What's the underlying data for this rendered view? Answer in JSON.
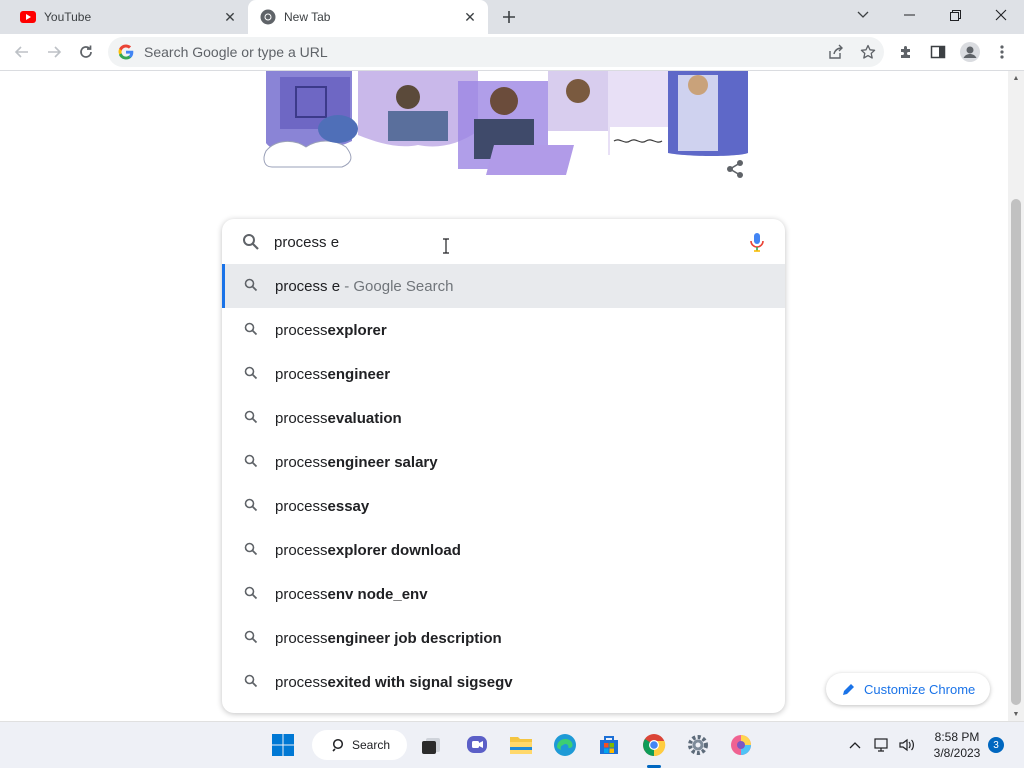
{
  "tabs": [
    {
      "title": "YouTube",
      "icon": "youtube-icon"
    },
    {
      "title": "New Tab",
      "icon": "chrome-icon"
    }
  ],
  "toolbar": {
    "omnibox_placeholder": "Search Google or type a URL"
  },
  "search": {
    "query": "process e",
    "suggestions": [
      {
        "prefix": "process e",
        "suffix": "",
        "note": " - Google Search",
        "selected": true
      },
      {
        "prefix": "process ",
        "suffix": "explorer",
        "note": ""
      },
      {
        "prefix": "process ",
        "suffix": "engineer",
        "note": ""
      },
      {
        "prefix": "process ",
        "suffix": "evaluation",
        "note": ""
      },
      {
        "prefix": "process ",
        "suffix": "engineer salary",
        "note": ""
      },
      {
        "prefix": "process ",
        "suffix": "essay",
        "note": ""
      },
      {
        "prefix": "process ",
        "suffix": "explorer download",
        "note": ""
      },
      {
        "prefix": "process ",
        "suffix": "env node_env",
        "note": ""
      },
      {
        "prefix": "process ",
        "suffix": "engineer job description",
        "note": ""
      },
      {
        "prefix": "process ",
        "suffix": "exited with signal sigsegv",
        "note": ""
      }
    ]
  },
  "customize": {
    "label": "Customize Chrome"
  },
  "taskbar": {
    "search_label": "Search",
    "time": "8:58 PM",
    "date": "3/8/2023",
    "notifications": "3"
  },
  "colors": {
    "accent": "#1a73e8",
    "tabstrip": "#dee1e6",
    "selected_row": "#e8eaed"
  }
}
